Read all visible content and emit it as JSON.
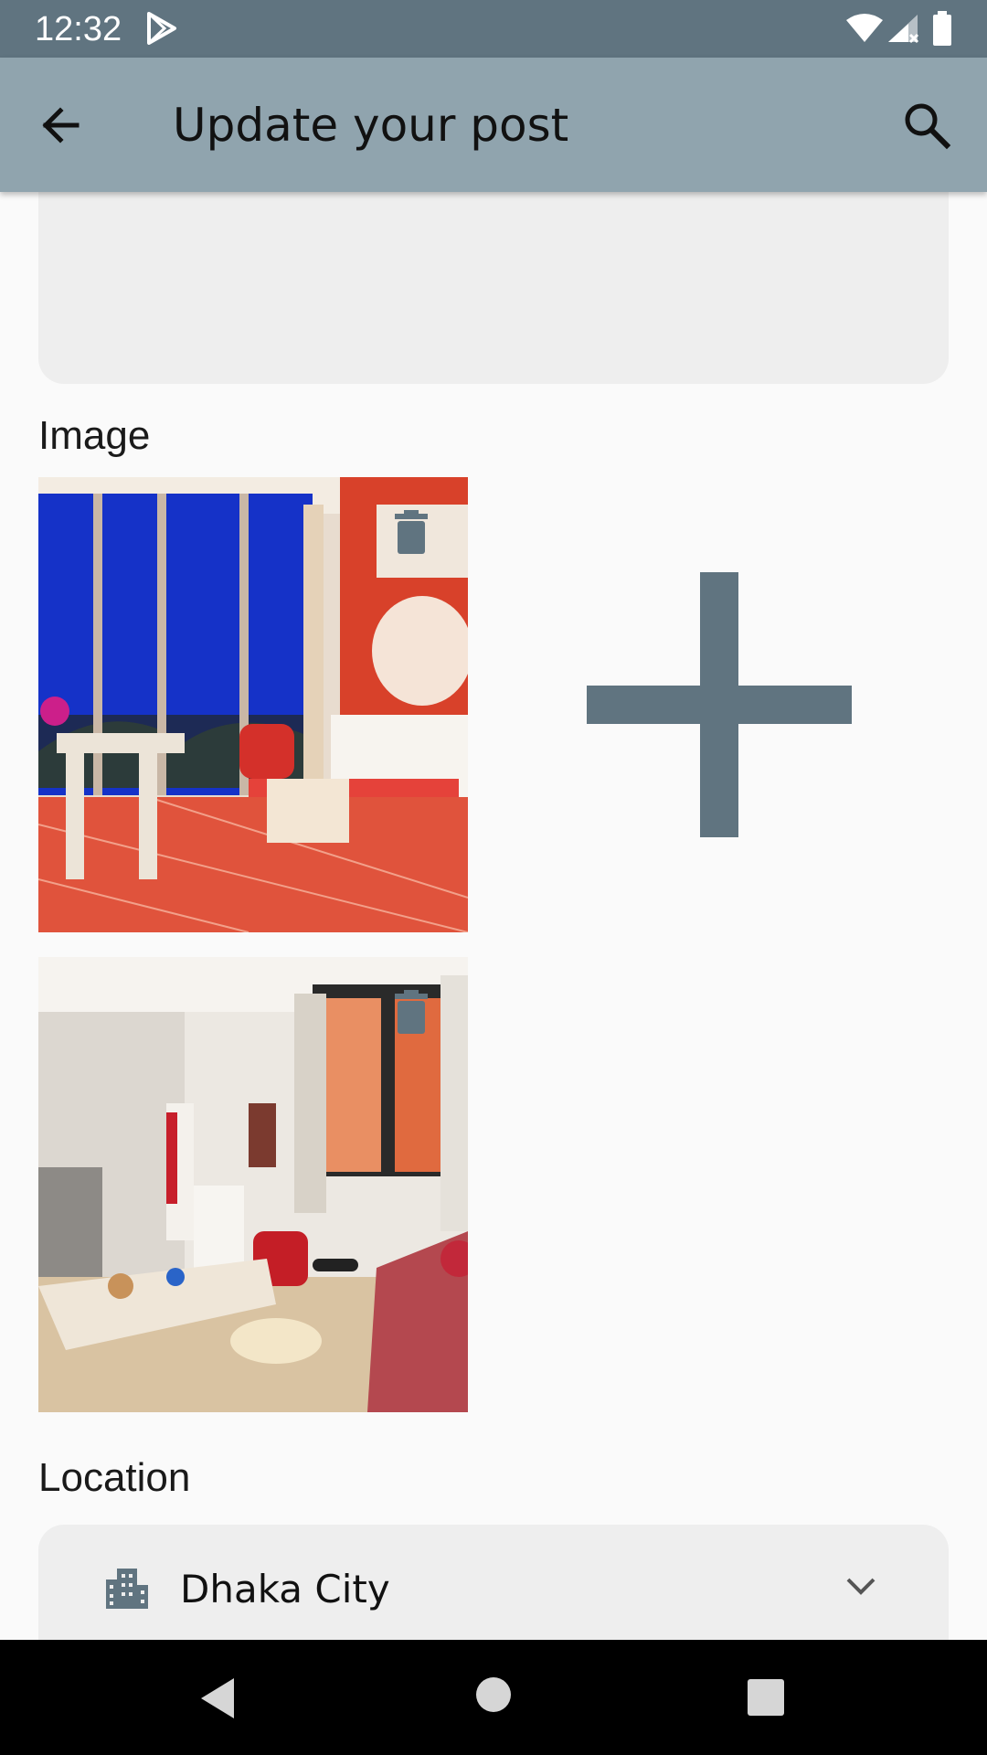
{
  "status_bar": {
    "time": "12:32",
    "icons": [
      "play-store-icon",
      "wifi-icon",
      "signal-icon",
      "battery-icon"
    ]
  },
  "app_bar": {
    "title": "Update your post",
    "back_icon": "arrow-back-icon",
    "search_icon": "search-icon"
  },
  "sections": {
    "image_label": "Image",
    "location_label": "Location"
  },
  "images": [
    {
      "name": "hotel-bedroom-photo",
      "action_icon": "delete-icon"
    },
    {
      "name": "living-room-photo",
      "action_icon": "delete-icon"
    }
  ],
  "add_image": {
    "icon": "plus-icon"
  },
  "location": {
    "value": "Dhaka City",
    "icon": "city-icon",
    "dropdown_icon": "chevron-down-icon"
  },
  "nav_bar": {
    "icons": [
      "nav-back-icon",
      "nav-home-icon",
      "nav-recents-icon"
    ]
  },
  "colors": {
    "status_bar": "#607480",
    "app_bar": "#90a4ae",
    "accent_icon": "#607480",
    "field_bg": "#eeeeee"
  }
}
